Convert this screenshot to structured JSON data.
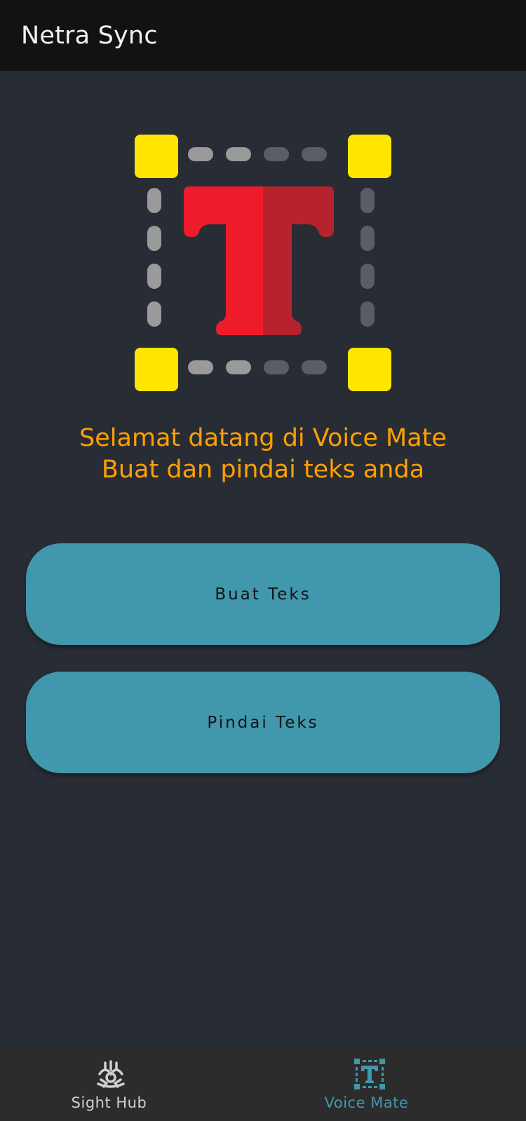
{
  "app_bar": {
    "title": "Netra Sync"
  },
  "hero": {
    "icon": "text-recognition-icon",
    "colors": {
      "corner": "#ffe500",
      "dash_light": "#9a9a9a",
      "dash_dark": "#5b5d62",
      "letter_left": "#ee1c2b",
      "letter_right": "#b7232c"
    }
  },
  "welcome": {
    "line1": "Selamat datang di Voice Mate",
    "line2": "Buat dan pindai teks anda",
    "color": "#ffa000"
  },
  "actions": {
    "create_label": "Buat Teks",
    "scan_label": "Pindai Teks",
    "color": "#4197ab"
  },
  "bottom_nav": {
    "items": [
      {
        "label": "Sight Hub",
        "icon": "sight-hub-icon",
        "active": false
      },
      {
        "label": "Voice Mate",
        "icon": "voice-mate-icon",
        "active": true
      }
    ],
    "active_color": "#4197ab"
  }
}
